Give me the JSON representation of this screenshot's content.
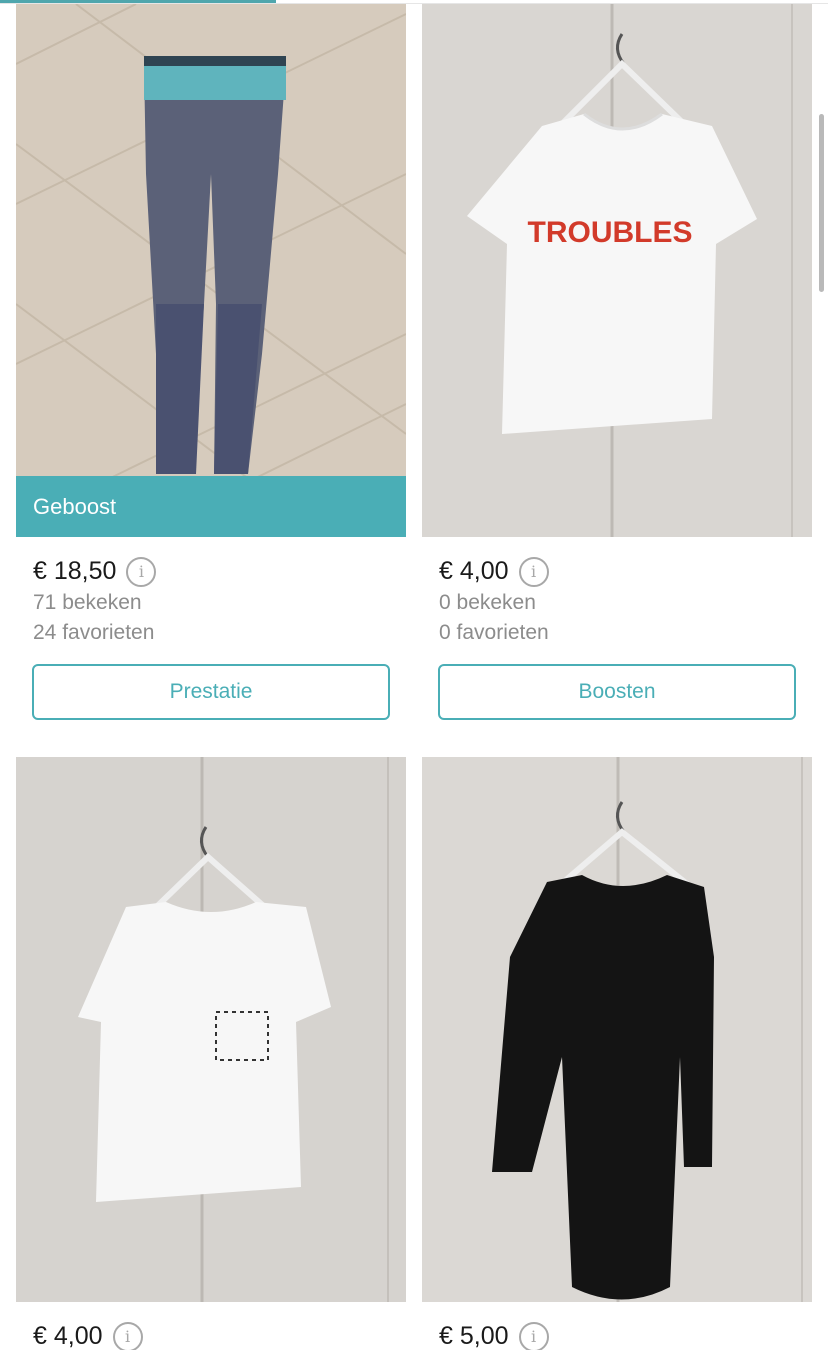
{
  "items": [
    {
      "price": "€ 18,50",
      "views": "71 bekeken",
      "favorites": "24 favorieten",
      "banner": "Geboost",
      "button": "Prestatie",
      "image_subject": "grey Gymshark leggings on wooden floor"
    },
    {
      "price": "€ 4,00",
      "views": "0 bekeken",
      "favorites": "0 favorieten",
      "button": "Boosten",
      "print_text": "TROUBLES",
      "image_subject": "white t-shirt on hanger"
    },
    {
      "price": "€ 4,00",
      "image_subject": "white t-shirt with pocket on hanger"
    },
    {
      "price": "€ 5,00",
      "image_subject": "black long-sleeve dress on hanger"
    }
  ],
  "colors": {
    "accent": "#4aaeb6",
    "muted_text": "#8c8c8c"
  }
}
